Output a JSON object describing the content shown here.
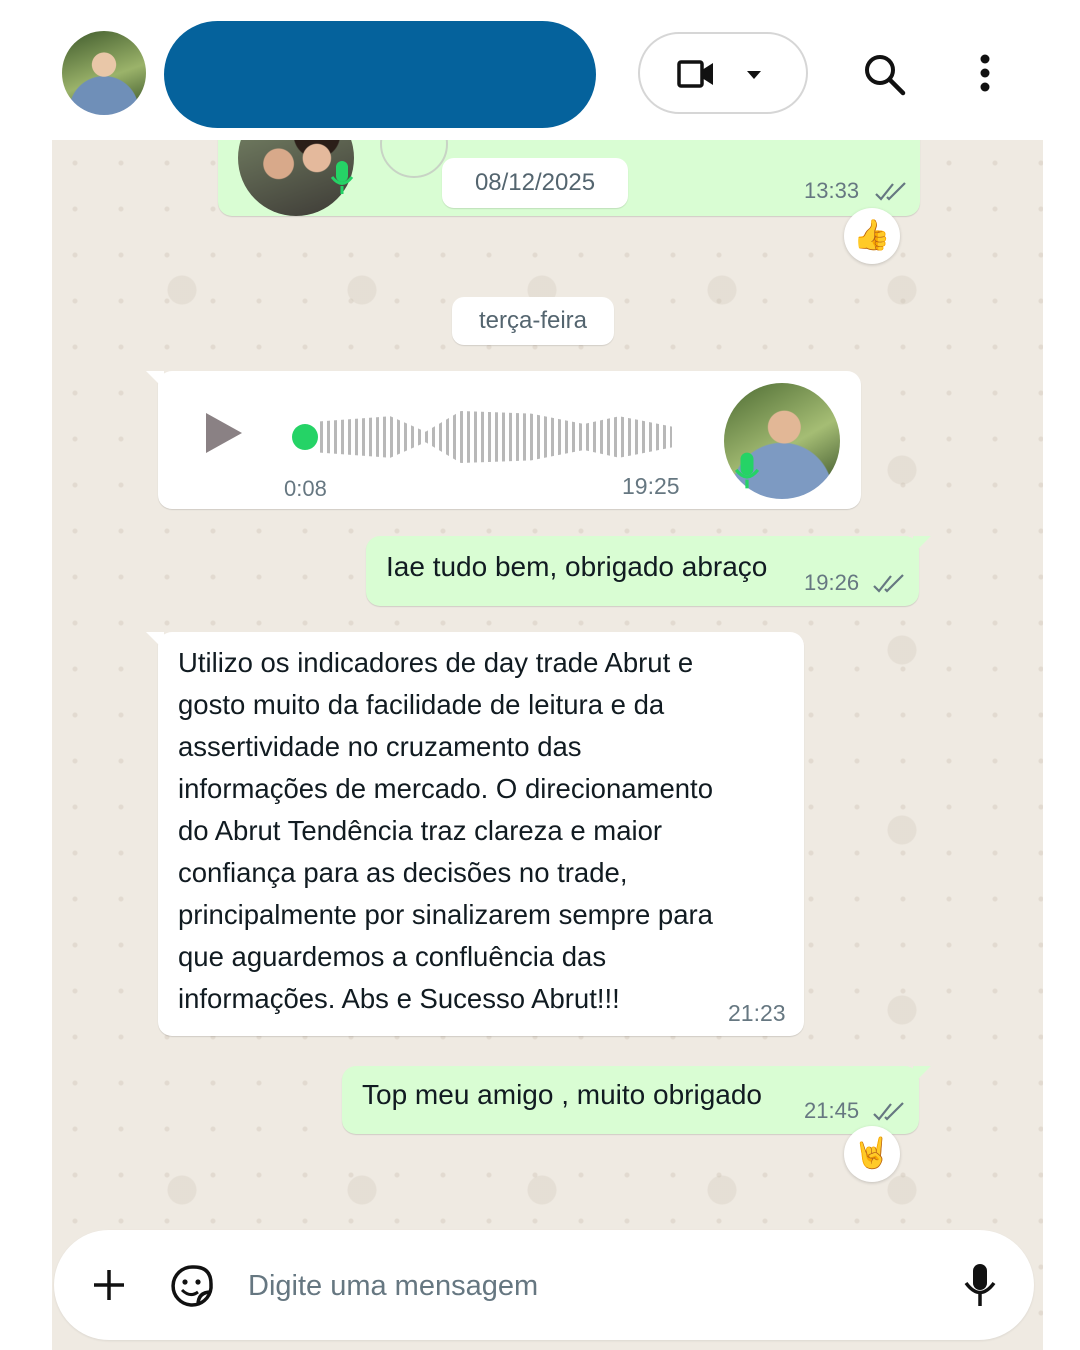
{
  "header": {
    "contact_avatar": "avatar",
    "icons": [
      "video-camera-icon",
      "chevron-down-icon",
      "search-icon",
      "more-vertical-icon"
    ]
  },
  "messages": {
    "top_audio": {
      "date_overlay": "08/12/2025",
      "time": "13:33",
      "reaction": "👍"
    },
    "day_separator": "terça-feira",
    "voice_note": {
      "duration": "0:08",
      "time": "19:25"
    },
    "out1": {
      "text": "Iae tudo bem, obrigado abraço",
      "time": "19:26"
    },
    "in1": {
      "lines": [
        "Utilizo os indicadores de day trade Abrut e",
        "gosto muito da facilidade de leitura e da",
        "assertividade no cruzamento das",
        "informações de mercado. O direcionamento",
        "do Abrut Tendência traz clareza e maior",
        "confiança para as decisões no trade,",
        "principalmente por sinalizarem sempre para",
        "que aguardemos a confluência das",
        "informações. Abs e Sucesso Abrut!!!"
      ],
      "time": "21:23"
    },
    "out2": {
      "text": "Top meu amigo , muito obrigado",
      "time": "21:45",
      "reaction": "🤘"
    }
  },
  "composer": {
    "placeholder": "Digite uma mensagem"
  },
  "colors": {
    "accent_header_redaction": "#05629c",
    "outgoing_bubble": "#d9fdd3",
    "incoming_bubble": "#ffffff",
    "chat_background": "#efeae2",
    "read_ticks": "#667781",
    "voice_progress": "#25d366"
  }
}
